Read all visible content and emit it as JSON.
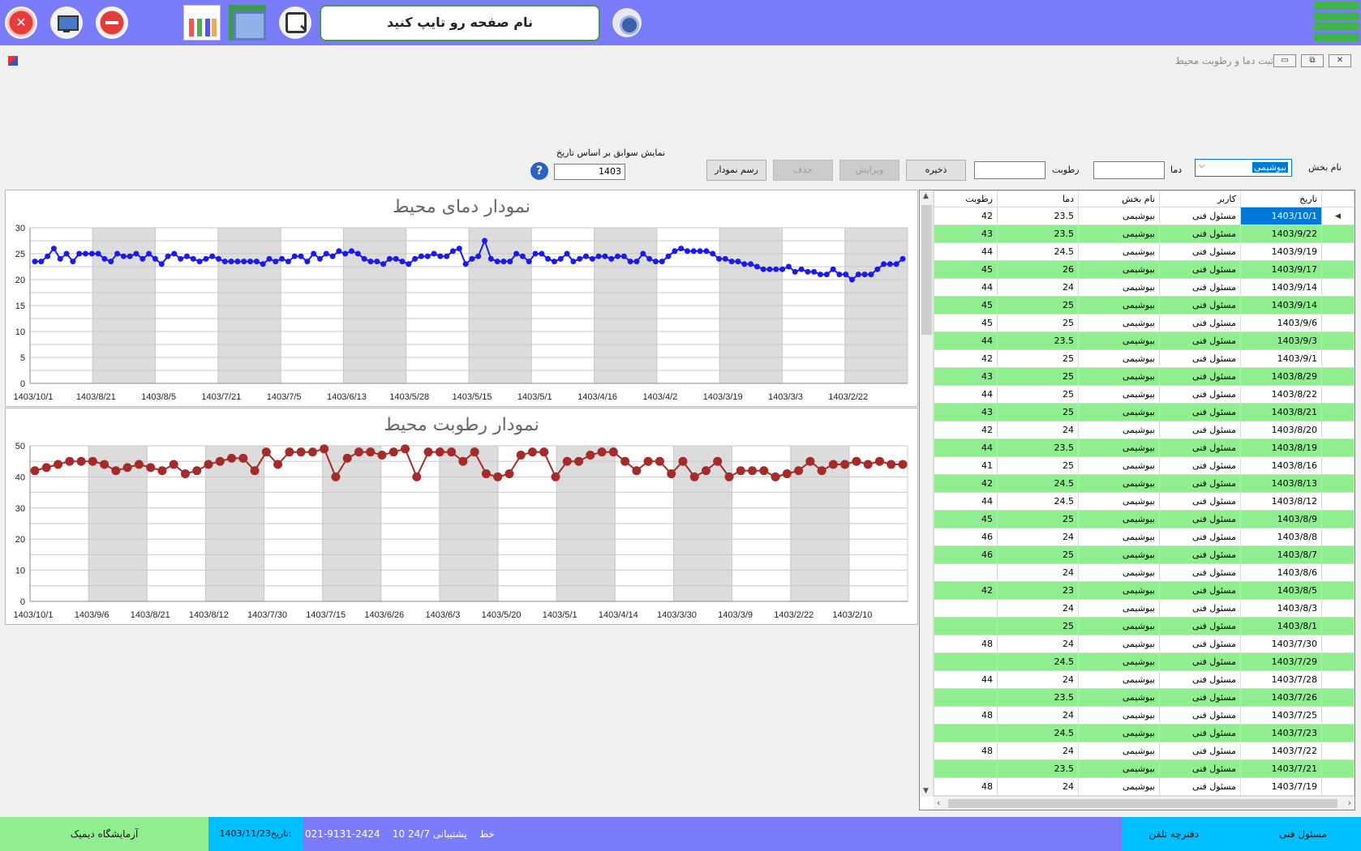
{
  "toolbar": {
    "page_search_label": "نام صفحه رو تایپ کنید"
  },
  "window": {
    "title": "ثبت دما و رطوبت محیط",
    "minimize": "▭",
    "restore": "⧉",
    "close": "✕"
  },
  "form": {
    "section_label": "نام بخش",
    "section_value": "بیوشیمی",
    "temp_label": "دما",
    "humidity_label": "رطوبت",
    "save_button": "ذخیره",
    "edit_button": "ویرایش",
    "delete_button": "حذف",
    "chart_button": "رسم نمودار",
    "filter_label": "نمایش سوابق بر اساس تاریخ",
    "filter_value": "1403",
    "help_icon": "?"
  },
  "chart_data": [
    {
      "type": "line",
      "title": "نمودار دمای محیط",
      "ylim": [
        0,
        30
      ],
      "yticks": [
        0,
        5,
        10,
        15,
        20,
        25,
        30
      ],
      "xtick_labels": [
        "1403/10/1",
        "1403/8/21",
        "1403/8/5",
        "1403/7/21",
        "1403/7/5",
        "1403/6/13",
        "1403/5/28",
        "1403/5/15",
        "1403/5/1",
        "1403/4/16",
        "1403/4/2",
        "1403/3/19",
        "1403/3/3",
        "1403/2/22"
      ],
      "color": "#1a1aee",
      "series": [
        {
          "values": [
            23.5,
            23.5,
            24.5,
            26,
            24,
            25,
            23.5,
            25,
            25,
            25,
            25,
            24,
            23.5,
            25,
            24.5,
            24.5,
            25,
            24,
            25,
            24,
            23,
            24.5,
            25,
            24,
            24.5,
            24,
            23.5,
            24,
            24.5,
            24,
            23.5,
            23.5,
            23.5,
            23.5,
            23.5,
            23.5,
            23,
            24,
            23.5,
            24,
            23.5,
            24.5,
            24.5,
            23.5,
            25,
            24,
            25,
            24.5,
            25.5,
            25,
            25.5,
            25,
            24,
            23.5,
            23.5,
            23,
            24,
            24,
            23.5,
            23,
            24,
            24.5,
            24.5,
            25,
            24.5,
            24.5,
            25.5,
            26,
            23,
            24,
            24.5,
            27.5,
            24,
            23.5,
            23.5,
            23.5,
            25,
            24.5,
            23.5,
            25,
            25,
            24,
            23.5,
            24,
            25,
            23.5,
            24,
            24.5,
            24,
            24.5,
            24.5,
            24,
            24.5,
            24.5,
            23.5,
            23.5,
            25,
            24,
            23.5,
            23.5,
            24.5,
            25.5,
            26,
            25.5,
            25.5,
            25.5,
            25.5,
            25,
            24,
            24,
            23.5,
            23.5,
            23,
            23,
            22.5,
            22,
            22,
            22,
            22,
            22.5,
            21.5,
            22,
            21.5,
            21.5,
            21,
            21,
            22,
            21,
            21,
            20,
            21,
            21,
            21,
            22,
            23,
            23,
            23,
            24
          ]
        }
      ]
    },
    {
      "type": "line",
      "title": "نمودار رطوبت محیط",
      "ylim": [
        0,
        50
      ],
      "yticks": [
        0,
        10,
        20,
        30,
        40,
        50
      ],
      "xtick_labels": [
        "1403/10/1",
        "1403/9/6",
        "1403/8/21",
        "1403/8/12",
        "1403/7/30",
        "1403/7/15",
        "1403/6/26",
        "1403/6/3",
        "1403/5/20",
        "1403/5/1",
        "1403/4/14",
        "1403/3/30",
        "1403/3/9",
        "1403/2/22",
        "1403/2/10"
      ],
      "color": "#a52a2a",
      "series": [
        {
          "values": [
            42,
            43,
            44,
            45,
            45,
            45,
            44,
            42,
            43,
            44,
            43,
            42,
            44,
            41,
            42,
            44,
            45,
            46,
            46,
            42,
            48,
            44,
            48,
            48,
            48,
            49,
            40,
            46,
            48,
            48,
            47,
            48,
            49,
            40,
            48,
            48,
            48,
            45,
            48,
            41,
            40,
            41,
            47,
            48,
            48,
            40,
            45,
            45,
            47,
            48,
            48,
            45,
            42,
            45,
            45,
            41,
            45,
            40,
            42,
            45,
            40,
            42,
            42,
            42,
            40,
            41,
            42,
            45,
            42,
            44,
            44,
            45,
            44,
            45,
            44,
            44
          ]
        }
      ]
    }
  ],
  "grid": {
    "headers": [
      "تاریخ",
      "کاربر",
      "نام بخش",
      "دما",
      "رطوبت"
    ],
    "rows": [
      [
        "1403/10/1",
        "مسئول فنی",
        "بیوشیمی",
        "23.5",
        "42"
      ],
      [
        "1403/9/22",
        "مسئول فنی",
        "بیوشیمی",
        "23.5",
        "43"
      ],
      [
        "1403/9/19",
        "مسئول فنی",
        "بیوشیمی",
        "24.5",
        "44"
      ],
      [
        "1403/9/17",
        "مسئول فنی",
        "بیوشیمی",
        "26",
        "45"
      ],
      [
        "1403/9/14",
        "مسئول فنی",
        "بیوشیمی",
        "24",
        "44"
      ],
      [
        "1403/9/14",
        "مسئول فنی",
        "بیوشیمی",
        "25",
        "45"
      ],
      [
        "1403/9/6",
        "مسئول فنی",
        "بیوشیمی",
        "25",
        "45"
      ],
      [
        "1403/9/3",
        "مسئول فنی",
        "بیوشیمی",
        "23.5",
        "44"
      ],
      [
        "1403/9/1",
        "مسئول فنی",
        "بیوشیمی",
        "25",
        "42"
      ],
      [
        "1403/8/29",
        "مسئول فنی",
        "بیوشیمی",
        "25",
        "43"
      ],
      [
        "1403/8/22",
        "مسئول فنی",
        "بیوشیمی",
        "25",
        "44"
      ],
      [
        "1403/8/21",
        "مسئول فنی",
        "بیوشیمی",
        "25",
        "43"
      ],
      [
        "1403/8/20",
        "مسئول فنی",
        "بیوشیمی",
        "24",
        "42"
      ],
      [
        "1403/8/19",
        "مسئول فنی",
        "بیوشیمی",
        "23.5",
        "44"
      ],
      [
        "1403/8/16",
        "مسئول فنی",
        "بیوشیمی",
        "25",
        "41"
      ],
      [
        "1403/8/13",
        "مسئول فنی",
        "بیوشیمی",
        "24.5",
        "42"
      ],
      [
        "1403/8/12",
        "مسئول فنی",
        "بیوشیمی",
        "24.5",
        "44"
      ],
      [
        "1403/8/9",
        "مسئول فنی",
        "بیوشیمی",
        "25",
        "45"
      ],
      [
        "1403/8/8",
        "مسئول فنی",
        "بیوشیمی",
        "24",
        "46"
      ],
      [
        "1403/8/7",
        "مسئول فنی",
        "بیوشیمی",
        "25",
        "46"
      ],
      [
        "1403/8/6",
        "مسئول فنی",
        "بیوشیمی",
        "24",
        ""
      ],
      [
        "1403/8/5",
        "مسئول فنی",
        "بیوشیمی",
        "23",
        "42"
      ],
      [
        "1403/8/3",
        "مسئول فنی",
        "بیوشیمی",
        "24",
        ""
      ],
      [
        "1403/8/1",
        "مسئول فنی",
        "بیوشیمی",
        "25",
        ""
      ],
      [
        "1403/7/30",
        "مسئول فنی",
        "بیوشیمی",
        "24",
        "48"
      ],
      [
        "1403/7/29",
        "مسئول فنی",
        "بیوشیمی",
        "24.5",
        ""
      ],
      [
        "1403/7/28",
        "مسئول فنی",
        "بیوشیمی",
        "24",
        "44"
      ],
      [
        "1403/7/26",
        "مسئول فنی",
        "بیوشیمی",
        "23.5",
        ""
      ],
      [
        "1403/7/25",
        "مسئول فنی",
        "بیوشیمی",
        "24",
        "48"
      ],
      [
        "1403/7/23",
        "مسئول فنی",
        "بیوشیمی",
        "24.5",
        ""
      ],
      [
        "1403/7/22",
        "مسئول فنی",
        "بیوشیمی",
        "24",
        "48"
      ],
      [
        "1403/7/21",
        "مسئول فنی",
        "بیوشیمی",
        "23.5",
        ""
      ],
      [
        "1403/7/19",
        "مسئول فنی",
        "بیوشیمی",
        "24",
        "48"
      ]
    ]
  },
  "status": {
    "lab_name": "آزمایشگاه دیمیک",
    "date_label": "تاریخ:",
    "date_value": "1403/11/23",
    "support": "پشتیبانی 24/7",
    "lines": "10 خط",
    "phone": "021-9131-2424",
    "phonebook": "دفترچه تلفن",
    "user": "مسئول فنی"
  }
}
